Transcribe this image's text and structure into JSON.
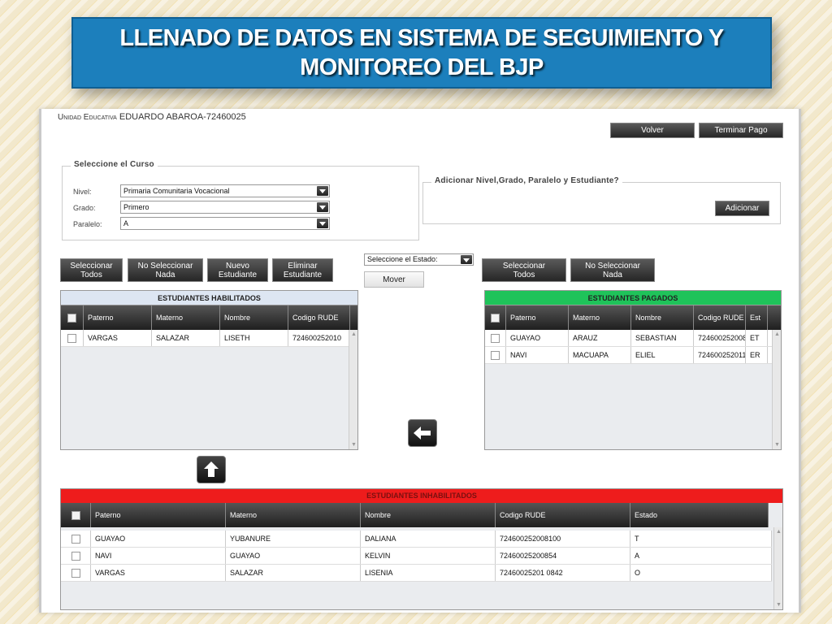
{
  "slide": {
    "title_line1": "LLENADO DE DATOS EN SISTEMA DE SEGUIMIENTO Y",
    "title_line2": "MONITOREO DEL BJP"
  },
  "header": {
    "school_prefix": "Unidad Educativa",
    "school_name": "EDUARDO ABAROA-72460025",
    "back_label": "Volver",
    "finish_label": "Terminar Pago"
  },
  "course": {
    "legend": "Seleccione el Curso",
    "nivel_label": "Nivel:",
    "nivel_value": "Primaria Comunitaria Vocacional",
    "grado_label": "Grado:",
    "grado_value": "Primero",
    "paralelo_label": "Paralelo:",
    "paralelo_value": "A"
  },
  "add_section": {
    "legend": "Adicionar Nivel,Grado, Paralelo y Estudiante?",
    "add_label": "Adicionar"
  },
  "left_actions": {
    "select_all": [
      "Seleccionar",
      "Todos"
    ],
    "select_none": [
      "No Seleccionar",
      "Nada"
    ],
    "new_student": [
      "Nuevo",
      "Estudiante"
    ],
    "delete_student": [
      "Eliminar",
      "Estudiante"
    ]
  },
  "middle": {
    "estado_value": "Seleccione el Estado:",
    "move_label": "Mover"
  },
  "right_actions": {
    "select_all": [
      "Seleccionar",
      "Todos"
    ],
    "select_none": [
      "No Seleccionar",
      "Nada"
    ]
  },
  "enabled_table": {
    "title": "ESTUDIANTES HABILITADOS",
    "columns": [
      "Paterno",
      "Materno",
      "Nombre",
      "Codigo RUDE"
    ],
    "rows": [
      [
        "VARGAS",
        "SALAZAR",
        "LISETH",
        "724600252010"
      ]
    ]
  },
  "paid_table": {
    "title": "ESTUDIANTES PAGADOS",
    "columns": [
      "Paterno",
      "Materno",
      "Nombre",
      "Codigo RUDE",
      "Est"
    ],
    "rows": [
      [
        "GUAYAO",
        "ARAUZ",
        "SEBASTIAN",
        "724600252008",
        "ET"
      ],
      [
        "NAVI",
        "MACUAPA",
        "ELIEL",
        "724600252011",
        "ER"
      ]
    ]
  },
  "disabled_table": {
    "title": "ESTUDIANTES INHABILITADOS",
    "columns": [
      "Paterno",
      "Materno",
      "Nombre",
      "Codigo RUDE",
      "Estado"
    ],
    "rows": [
      [
        "GUAYAO",
        "YUBANURE",
        "DALIANA",
        "724600252008100",
        "T"
      ],
      [
        "NAVI",
        "GUAYAO",
        "KELVIN",
        "72460025200854",
        "A"
      ],
      [
        "VARGAS",
        "SALAZAR",
        "LISENIA",
        "72460025201 0842",
        "O"
      ]
    ]
  },
  "colors": {
    "banner": "#1c7fbc",
    "enabled_header": "#dde6f2",
    "paid_header": "#1fc35a",
    "disabled_header": "#ee1c1c"
  },
  "icons": {
    "move_left": "arrow-left-icon",
    "move_up": "arrow-up-icon"
  }
}
